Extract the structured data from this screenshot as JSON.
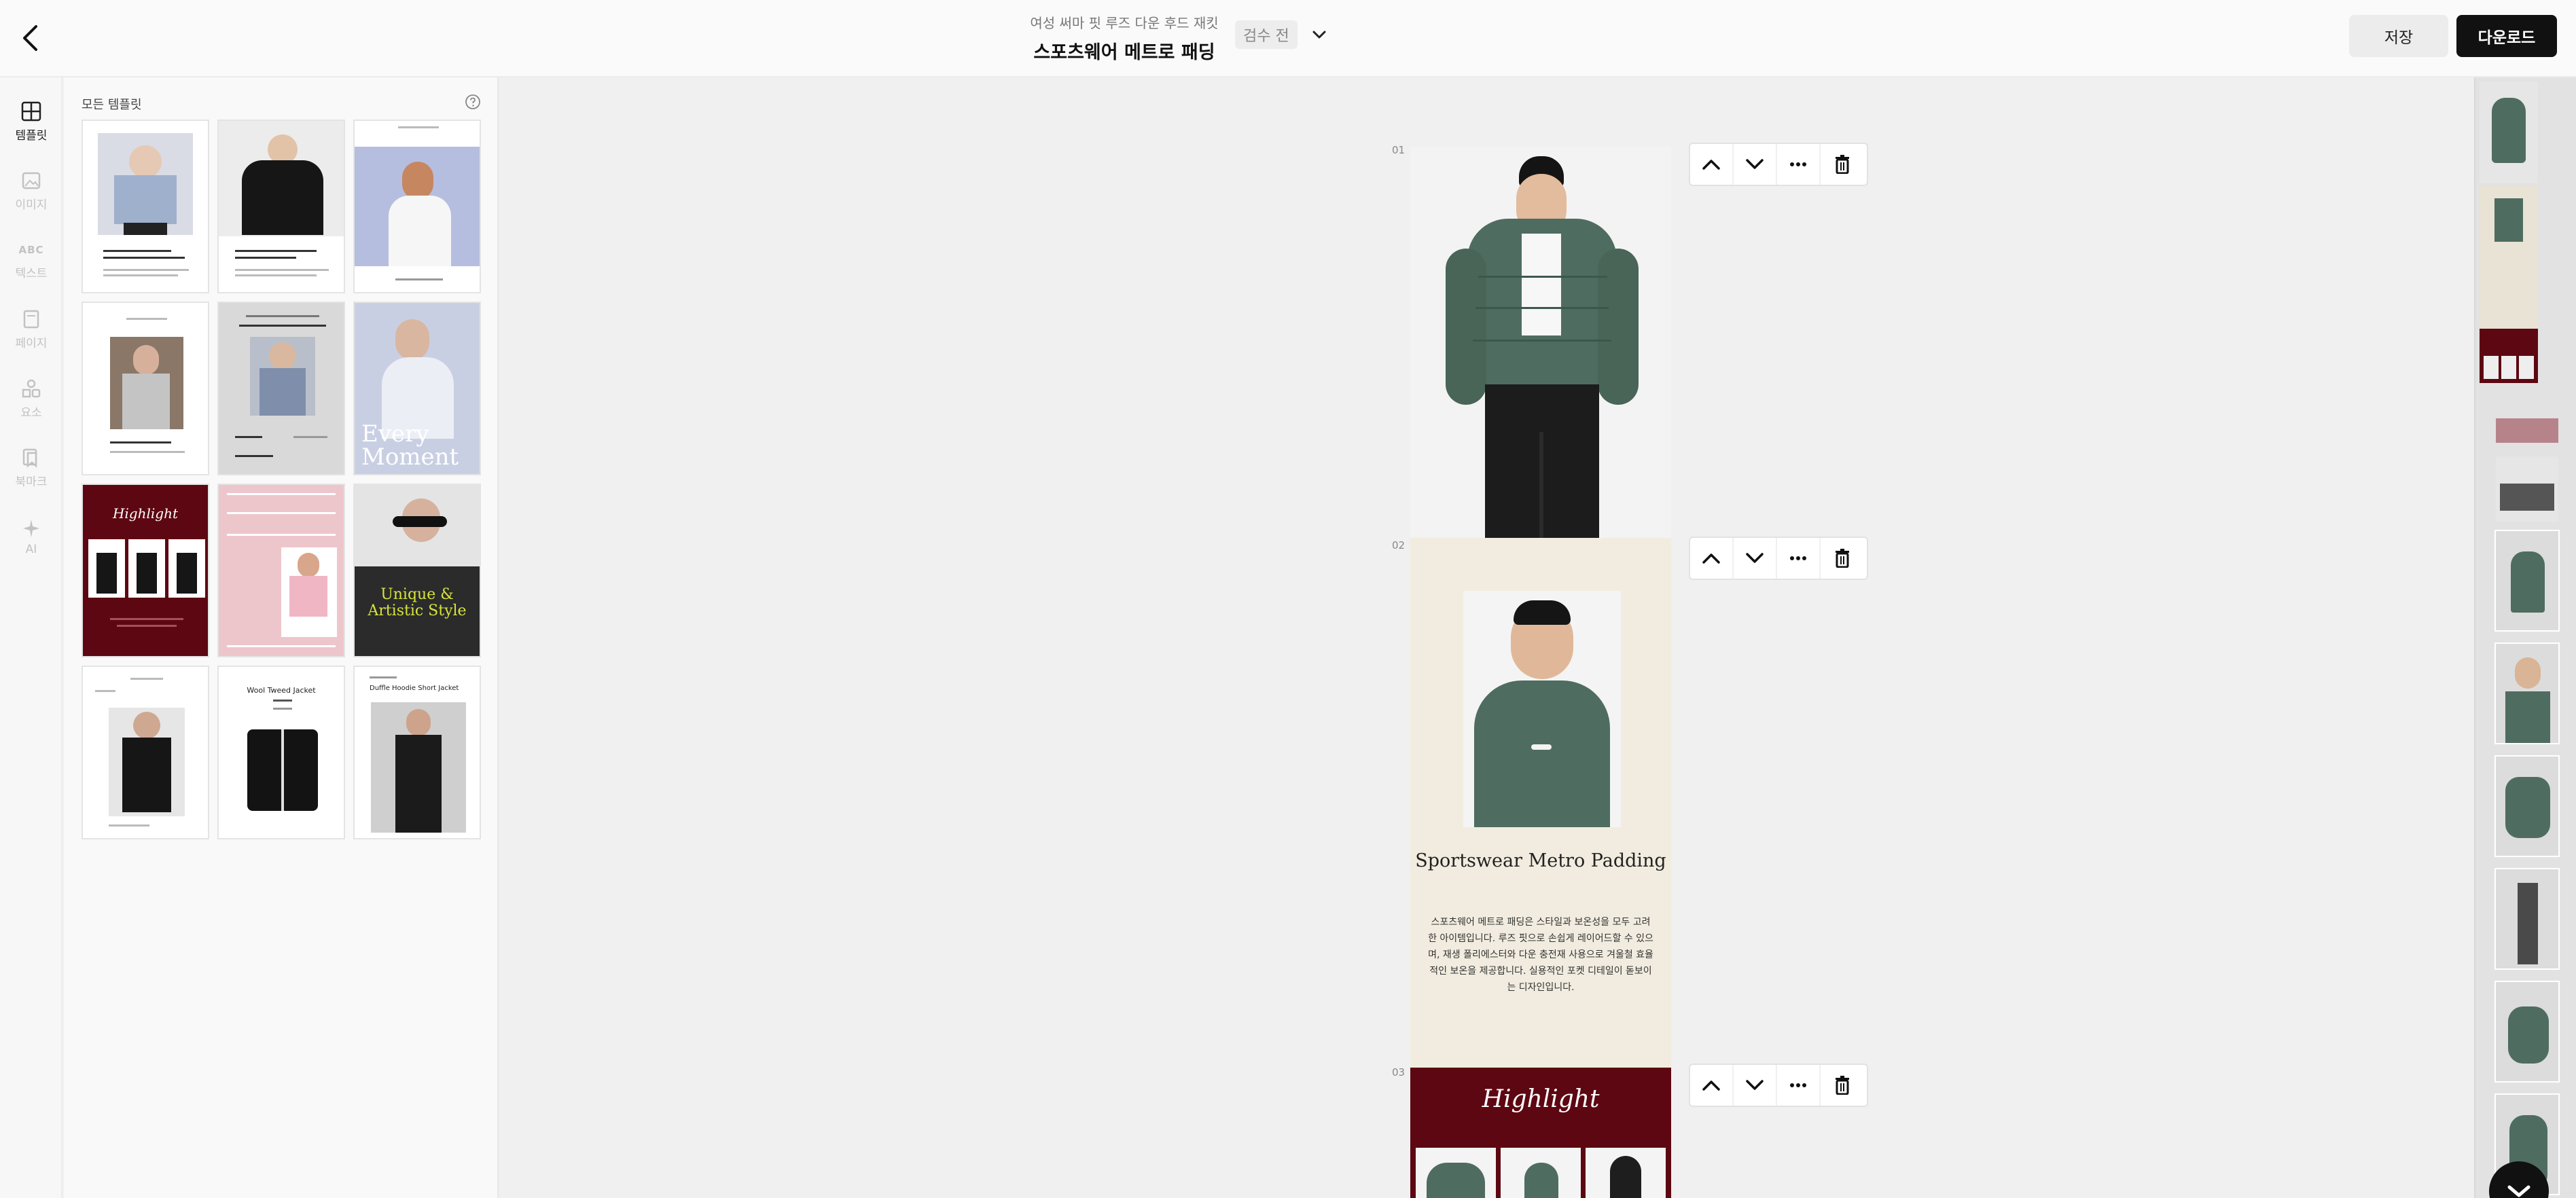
{
  "header": {
    "subtitle": "여성 써마 핏 루즈 다운 후드 재킷",
    "title": "스포츠웨어 메트로 패딩",
    "status": "검수 전",
    "save_label": "저장",
    "download_label": "다운로드"
  },
  "rail": {
    "items": [
      {
        "label": "템플릿",
        "icon": "template-grid-icon"
      },
      {
        "label": "이미지",
        "icon": "image-icon"
      },
      {
        "label": "텍스트",
        "icon": "text-abc-icon",
        "glyph": "ABC"
      },
      {
        "label": "페이지",
        "icon": "page-icon"
      },
      {
        "label": "요소",
        "icon": "elements-icon"
      },
      {
        "label": "북마크",
        "icon": "bookmark-icon"
      },
      {
        "label": "AI",
        "icon": "ai-sparkle-icon"
      }
    ]
  },
  "panel": {
    "title": "모든 템플릿",
    "templates": [
      {
        "art_text": ""
      },
      {
        "art_text": ""
      },
      {
        "art_text": ""
      },
      {
        "art_text": ""
      },
      {
        "art_text": ""
      },
      {
        "art_text": "Every Moment"
      },
      {
        "art_text": "Highlight"
      },
      {
        "art_text": ""
      },
      {
        "art_text": "Unique & Artistic Style"
      },
      {
        "art_text": ""
      },
      {
        "art_text": "Wool Tweed Jacket"
      },
      {
        "art_text": "Duffle Hoodie Short Jacket"
      }
    ]
  },
  "canvas": {
    "pages": [
      {
        "number": "01"
      },
      {
        "number": "02",
        "title": "Sportswear Metro Padding",
        "description": "스포츠웨어 메트로 패딩은 스타일과 보온성을 모두 고려한 아이템입니다. 루즈 핏으로 손쉽게 레이어드할 수 있으며, 재생 폴리에스터와 다운 충전재 사용으로 겨울철 효율적인 보온을 제공합니다. 실용적인 포켓 디테일이 돋보이는 디자인입니다."
      },
      {
        "number": "03",
        "title": "Highlight"
      }
    ]
  },
  "colors": {
    "jacket": "#4f6c60",
    "highlight_bg": "#5d0712",
    "page2_bg": "#f1ecdf",
    "accent_dark": "#111111"
  }
}
